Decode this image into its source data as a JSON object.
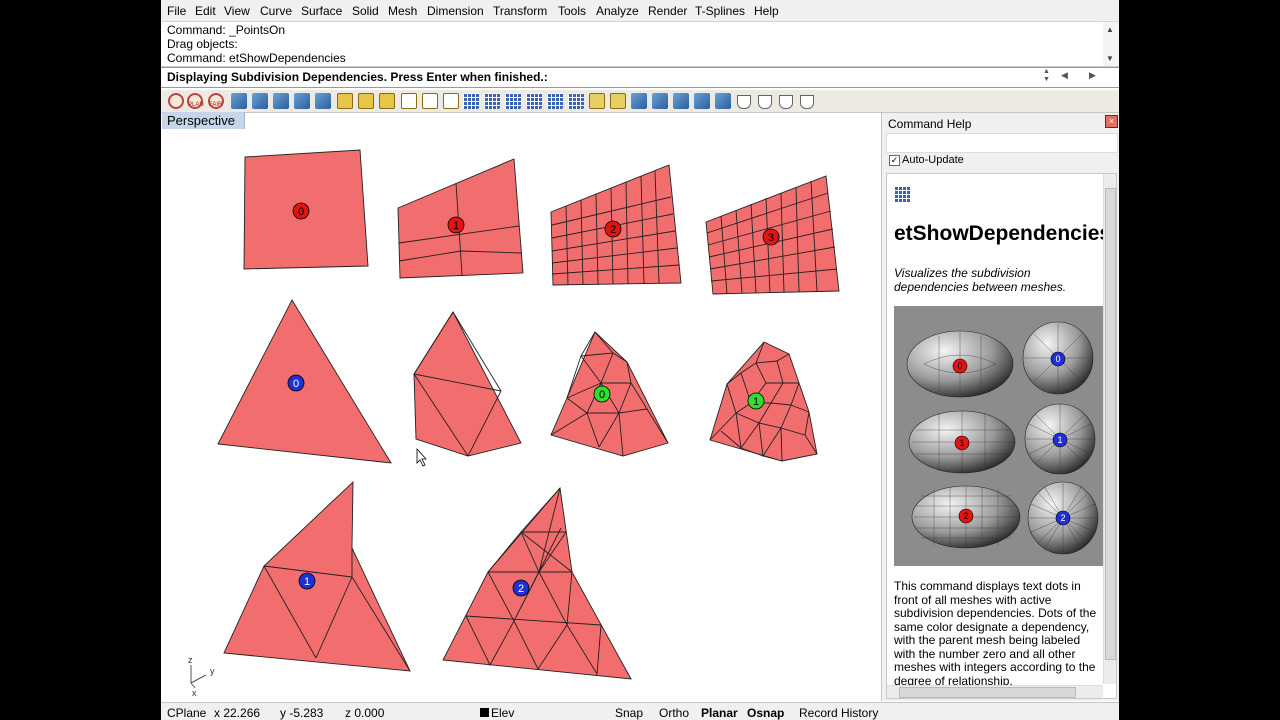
{
  "menu": [
    "File",
    "Edit",
    "View",
    "Curve",
    "Surface",
    "Solid",
    "Mesh",
    "Dimension",
    "Transform",
    "Tools",
    "Analyze",
    "Render",
    "T-Splines",
    "Help"
  ],
  "command_history": [
    "Command: _PointsOn",
    "Drag objects:",
    "Command: etShowDependencies"
  ],
  "prompt": "Displaying Subdivision Dependencies. Press Enter when finished.:",
  "toolbar": {
    "plan_label": "PLAN",
    "fair_label": "FAIR"
  },
  "viewport": {
    "label": "Perspective"
  },
  "dots": {
    "quad_1": "0",
    "quad_2": "1",
    "quad_3": "2",
    "quad_4": "3",
    "tri_large": "0",
    "tri_green_1": "0",
    "tri_green_2": "1",
    "tri_bottom_1": "1",
    "tri_bottom_2": "2"
  },
  "axes": {
    "z": "z",
    "y": "y",
    "x": "x"
  },
  "help_panel": {
    "title": "Command Help",
    "auto_update_label": "Auto-Update",
    "auto_update_checked": true,
    "command_name": "etShowDependencies",
    "summary": "Visualizes the subdivision dependencies between meshes.",
    "image_dots": [
      "0",
      "0",
      "1",
      "1",
      "2",
      "2"
    ],
    "body": "This command displays text dots in front of all meshes with active subdivision dependencies. Dots of the same color designate a dependency, with the parent mesh being labeled with the number zero and all other meshes with integers according to the degree of relationship."
  },
  "status": {
    "cplane": "CPlane",
    "x": "x 22.266",
    "y": "y -5.283",
    "z": "z 0.000",
    "elev": "Elev",
    "snap": "Snap",
    "ortho": "Ortho",
    "planar": "Planar",
    "osnap": "Osnap",
    "record_history": "Record History"
  },
  "colors": {
    "mesh_fill": "#f26d6d",
    "dot_red": "#e21313",
    "dot_blue": "#1f2fd6",
    "dot_green": "#2ee02e",
    "viewport_tab": "#c6d6ea"
  }
}
